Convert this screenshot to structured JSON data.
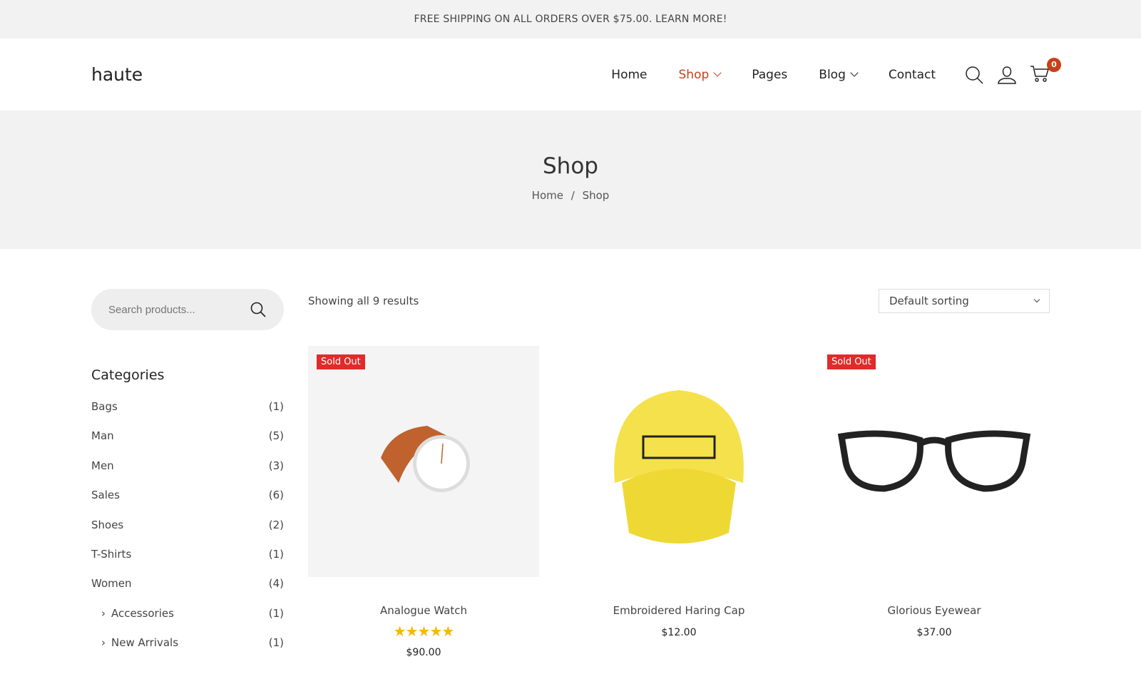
{
  "topbar": {
    "text": "FREE SHIPPING ON ALL ORDERS OVER $75.00. LEARN MORE!"
  },
  "header": {
    "logo": "haute",
    "nav": [
      {
        "label": "Home"
      },
      {
        "label": "Shop"
      },
      {
        "label": "Pages"
      },
      {
        "label": "Blog"
      },
      {
        "label": "Contact"
      }
    ],
    "cart_count": "0",
    "accent": "#c8401a"
  },
  "hero": {
    "title": "Shop",
    "breadcrumb": [
      "Home",
      "/",
      "Shop"
    ]
  },
  "sidebar": {
    "search_placeholder": "Search products...",
    "categories_title": "Categories",
    "categories": [
      {
        "name": "Bags",
        "count": "(1)"
      },
      {
        "name": "Man",
        "count": "(5)"
      },
      {
        "name": "Men",
        "count": "(3)"
      },
      {
        "name": "Sales",
        "count": "(6)"
      },
      {
        "name": "Shoes",
        "count": "(2)"
      },
      {
        "name": "T-Shirts",
        "count": "(1)"
      },
      {
        "name": "Women",
        "count": "(4)"
      },
      {
        "name": "Accessories",
        "count": "(1)"
      },
      {
        "name": "New Arrivals",
        "count": "(1)"
      }
    ]
  },
  "shop": {
    "results": "Showing all 9 results",
    "sorting": "Default sorting",
    "products": [
      {
        "name": "Analogue Watch",
        "price": "$90.00",
        "badge": "Sold Out",
        "rating": 4.85,
        "stars": "★★★★★"
      },
      {
        "name": "Embroidered Haring Cap",
        "price": "$12.00"
      },
      {
        "name": "Glorious Eyewear",
        "price": "$37.00",
        "badge": "Sold Out"
      }
    ]
  }
}
